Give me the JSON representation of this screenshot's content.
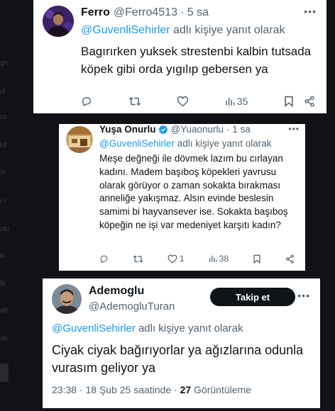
{
  "background_hints": [
    "gh",
    "dl",
    "ss",
    "ldi",
    "m",
    "r i",
    "olu",
    "ki",
    "ğı",
    "afi",
    "ati"
  ],
  "tweets": [
    {
      "name": "Ferro",
      "handle": "@Ferro4513",
      "time": "· 5 sa",
      "reply_handle": "@GuvenliSehirler",
      "reply_suffix": " adlı kişiye yanıt olarak",
      "text": "Bagırırken yuksek strestenbi kalbin tutsada köpek gibi orda yıgılıp gebersen ya",
      "views": "35"
    },
    {
      "name": "Yuşa Onurlu",
      "handle": "@Yuaonurlu",
      "time": "· 1 sa",
      "reply_handle": "@GuvenliSehirler",
      "reply_suffix": " adlı kişiye yanıt olarak",
      "text": "Meşe değneği ile dövmek lazım bu cırlayan kadını. Madem başıboş köpekleri yavrusu olarak görüyor o zaman sokakta bırakması anneliğe yakışmaz. Alsın evinde beslesin samimi bi hayvansever ise. Sokakta başıboş köpeğin ne işi var medeniyet karşıtı kadın?",
      "likes": "1",
      "views": "38"
    },
    {
      "name": "Ademoglu",
      "handle": "@AdemogluTuran",
      "follow_label": "Takip et",
      "reply_handle": "@GuvenliSehirler",
      "reply_suffix": " adlı kişiye yanıt olarak",
      "text": "Ciyak ciyak bağırıyorlar ya ağızlarına odunla vurasım geliyor ya",
      "timestamp": "23:38 · 18 Şub 25 saatinde · ",
      "views": "27",
      "views_label": " Görüntüleme"
    }
  ],
  "icons": {
    "reply": "reply-icon",
    "retweet": "retweet-icon",
    "like": "heart-icon",
    "views": "views-icon",
    "bookmark": "bookmark-icon",
    "share": "share-icon",
    "more": "more-icon",
    "verified": "verified-badge-icon"
  },
  "colors": {
    "link": "#1d9bf0",
    "muted": "#536471",
    "text": "#0f1419",
    "verified": "#1d9bf0"
  }
}
